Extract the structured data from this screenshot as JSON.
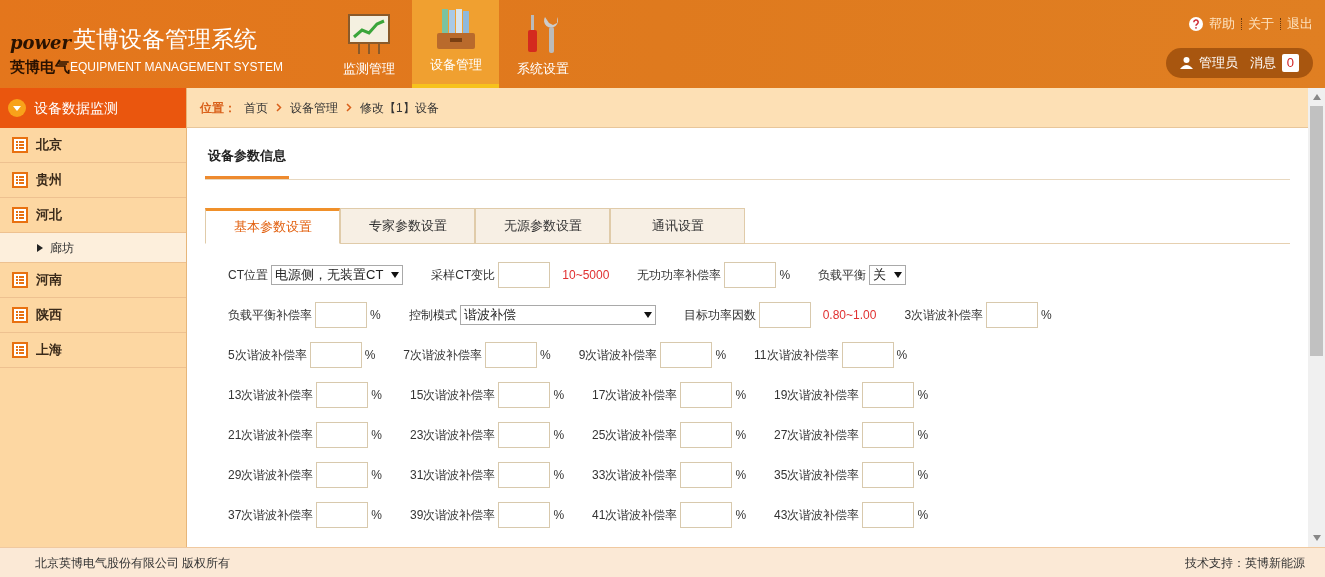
{
  "header": {
    "logo_mark": "power",
    "logo_brand": "英博电气",
    "title": "英博设备管理系统",
    "subtitle": "EQUIPMENT MANAGEMENT SYSTEM",
    "nav": [
      {
        "label": "监测管理",
        "kind": "chart",
        "selected": false
      },
      {
        "label": "设备管理",
        "kind": "binders",
        "selected": true
      },
      {
        "label": "系统设置",
        "kind": "tools",
        "selected": false
      }
    ],
    "links": [
      "帮助",
      "关于",
      "退出"
    ],
    "user": "管理员",
    "messages_label": "消息",
    "messages_count": "0"
  },
  "sidebar": {
    "title": "设备数据监测",
    "items": [
      {
        "label": "北京"
      },
      {
        "label": "贵州"
      },
      {
        "label": "河北",
        "children": [
          {
            "label": "廊坊"
          }
        ]
      },
      {
        "label": "河南"
      },
      {
        "label": "陕西"
      },
      {
        "label": "上海"
      }
    ]
  },
  "breadcrumb": {
    "label": "位置：",
    "items": [
      "首页",
      "设备管理",
      "修改【1】设备"
    ]
  },
  "section_title": "设备参数信息",
  "tabs": [
    {
      "label": "基本参数设置",
      "selected": true
    },
    {
      "label": "专家参数设置",
      "selected": false
    },
    {
      "label": "无源参数设置",
      "selected": false
    },
    {
      "label": "通讯设置",
      "selected": false
    }
  ],
  "form_rows": [
    [
      {
        "label": "CT位置",
        "kind": "select",
        "value": "电源侧，无装置CT"
      },
      {
        "label": "采样CT变比",
        "kind": "input",
        "hint": "10~5000"
      },
      {
        "label": "无功功率补偿率",
        "kind": "input",
        "unit": "%"
      },
      {
        "label": "负载平衡",
        "kind": "select",
        "value": "关"
      }
    ],
    [
      {
        "label": "负载平衡补偿率",
        "kind": "input",
        "unit": "%"
      },
      {
        "label": "控制模式",
        "kind": "wide_select",
        "value": "谐波补偿"
      },
      {
        "label": "目标功率因数",
        "kind": "input",
        "hint": "0.80~1.00"
      },
      {
        "label": "3次谐波补偿率",
        "kind": "input",
        "unit": "%"
      }
    ],
    [
      {
        "label": "5次谐波补偿率",
        "kind": "input",
        "unit": "%"
      },
      {
        "label": "7次谐波补偿率",
        "kind": "input",
        "unit": "%"
      },
      {
        "label": "9次谐波补偿率",
        "kind": "input",
        "unit": "%"
      },
      {
        "label": "11次谐波补偿率",
        "kind": "input",
        "unit": "%"
      }
    ],
    [
      {
        "label": "13次谐波补偿率",
        "kind": "input",
        "unit": "%"
      },
      {
        "label": "15次谐波补偿率",
        "kind": "input",
        "unit": "%"
      },
      {
        "label": "17次谐波补偿率",
        "kind": "input",
        "unit": "%"
      },
      {
        "label": "19次谐波补偿率",
        "kind": "input",
        "unit": "%"
      }
    ],
    [
      {
        "label": "21次谐波补偿率",
        "kind": "input",
        "unit": "%"
      },
      {
        "label": "23次谐波补偿率",
        "kind": "input",
        "unit": "%"
      },
      {
        "label": "25次谐波补偿率",
        "kind": "input",
        "unit": "%"
      },
      {
        "label": "27次谐波补偿率",
        "kind": "input",
        "unit": "%"
      }
    ],
    [
      {
        "label": "29次谐波补偿率",
        "kind": "input",
        "unit": "%"
      },
      {
        "label": "31次谐波补偿率",
        "kind": "input",
        "unit": "%"
      },
      {
        "label": "33次谐波补偿率",
        "kind": "input",
        "unit": "%"
      },
      {
        "label": "35次谐波补偿率",
        "kind": "input",
        "unit": "%"
      }
    ],
    [
      {
        "label": "37次谐波补偿率",
        "kind": "input",
        "unit": "%"
      },
      {
        "label": "39次谐波补偿率",
        "kind": "input",
        "unit": "%"
      },
      {
        "label": "41次谐波补偿率",
        "kind": "input",
        "unit": "%"
      },
      {
        "label": "43次谐波补偿率",
        "kind": "input",
        "unit": "%"
      }
    ]
  ],
  "footer": {
    "copyright": "北京英博电气股份有限公司 版权所有",
    "support": "技术支持：英博新能源"
  }
}
